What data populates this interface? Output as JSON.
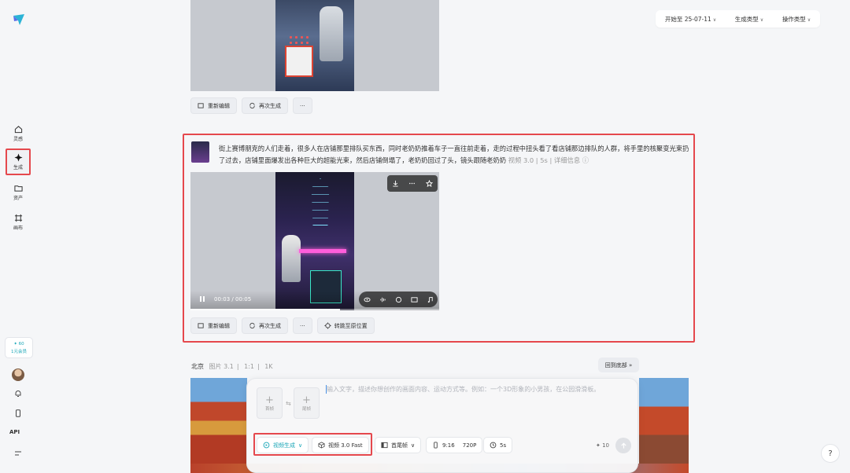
{
  "colors": {
    "accent": "#1aa6b7",
    "highlight": "#e5484d",
    "background": "#f5f6f8"
  },
  "sidebar": {
    "items": [
      {
        "label": "灵感",
        "icon": "home-icon"
      },
      {
        "label": "生成",
        "icon": "sparkle-icon"
      },
      {
        "label": "资产",
        "icon": "folder-icon"
      },
      {
        "label": "画布",
        "icon": "canvas-icon"
      }
    ],
    "credits": {
      "amount": "60",
      "plan": "1元会员"
    },
    "api_label": "API"
  },
  "filters": {
    "date": "开始至 25-07-11",
    "gen_type": "生成类型",
    "op_type": "操作类型"
  },
  "actions": {
    "reedit": "重新编辑",
    "regenerate": "再次生成",
    "more": "···",
    "jump": "转跳至原位置"
  },
  "card": {
    "prompt": "街上赛博朋克的人们走着，很多人在店铺那里排队买东西，同时老奶奶推着车子一直往前走着，走的过程中扭头看了看店铺那边排队的人群，将手里的核聚变光束扔了过去，店铺里面爆发出各种巨大的超能光束，然后店铺倒塌了，老奶奶回过了头，镜头跟随老奶奶",
    "model": "视频 3.0",
    "duration": "5s",
    "detail_link": "详细信息",
    "video": {
      "current": "00:03",
      "total": "00:05",
      "progress": 0.6
    }
  },
  "next_section": {
    "title": "北京",
    "type": "图片 3.1",
    "ratio": "1:1",
    "resolution": "1K",
    "back_to_bottom": "回到底部"
  },
  "composer": {
    "first_frame": "首帧",
    "last_frame": "尾帧",
    "placeholder": "输入文字，描述你想创作的画面内容、运动方式等。例如：一个3D形象的小男孩，在公园滑滑板。",
    "mode": "视频生成",
    "model": "视频 3.0 Fast",
    "frame_mode": "首尾帧",
    "aspect": "9:16",
    "resolution": "720P",
    "duration": "5s",
    "credits": "10"
  }
}
